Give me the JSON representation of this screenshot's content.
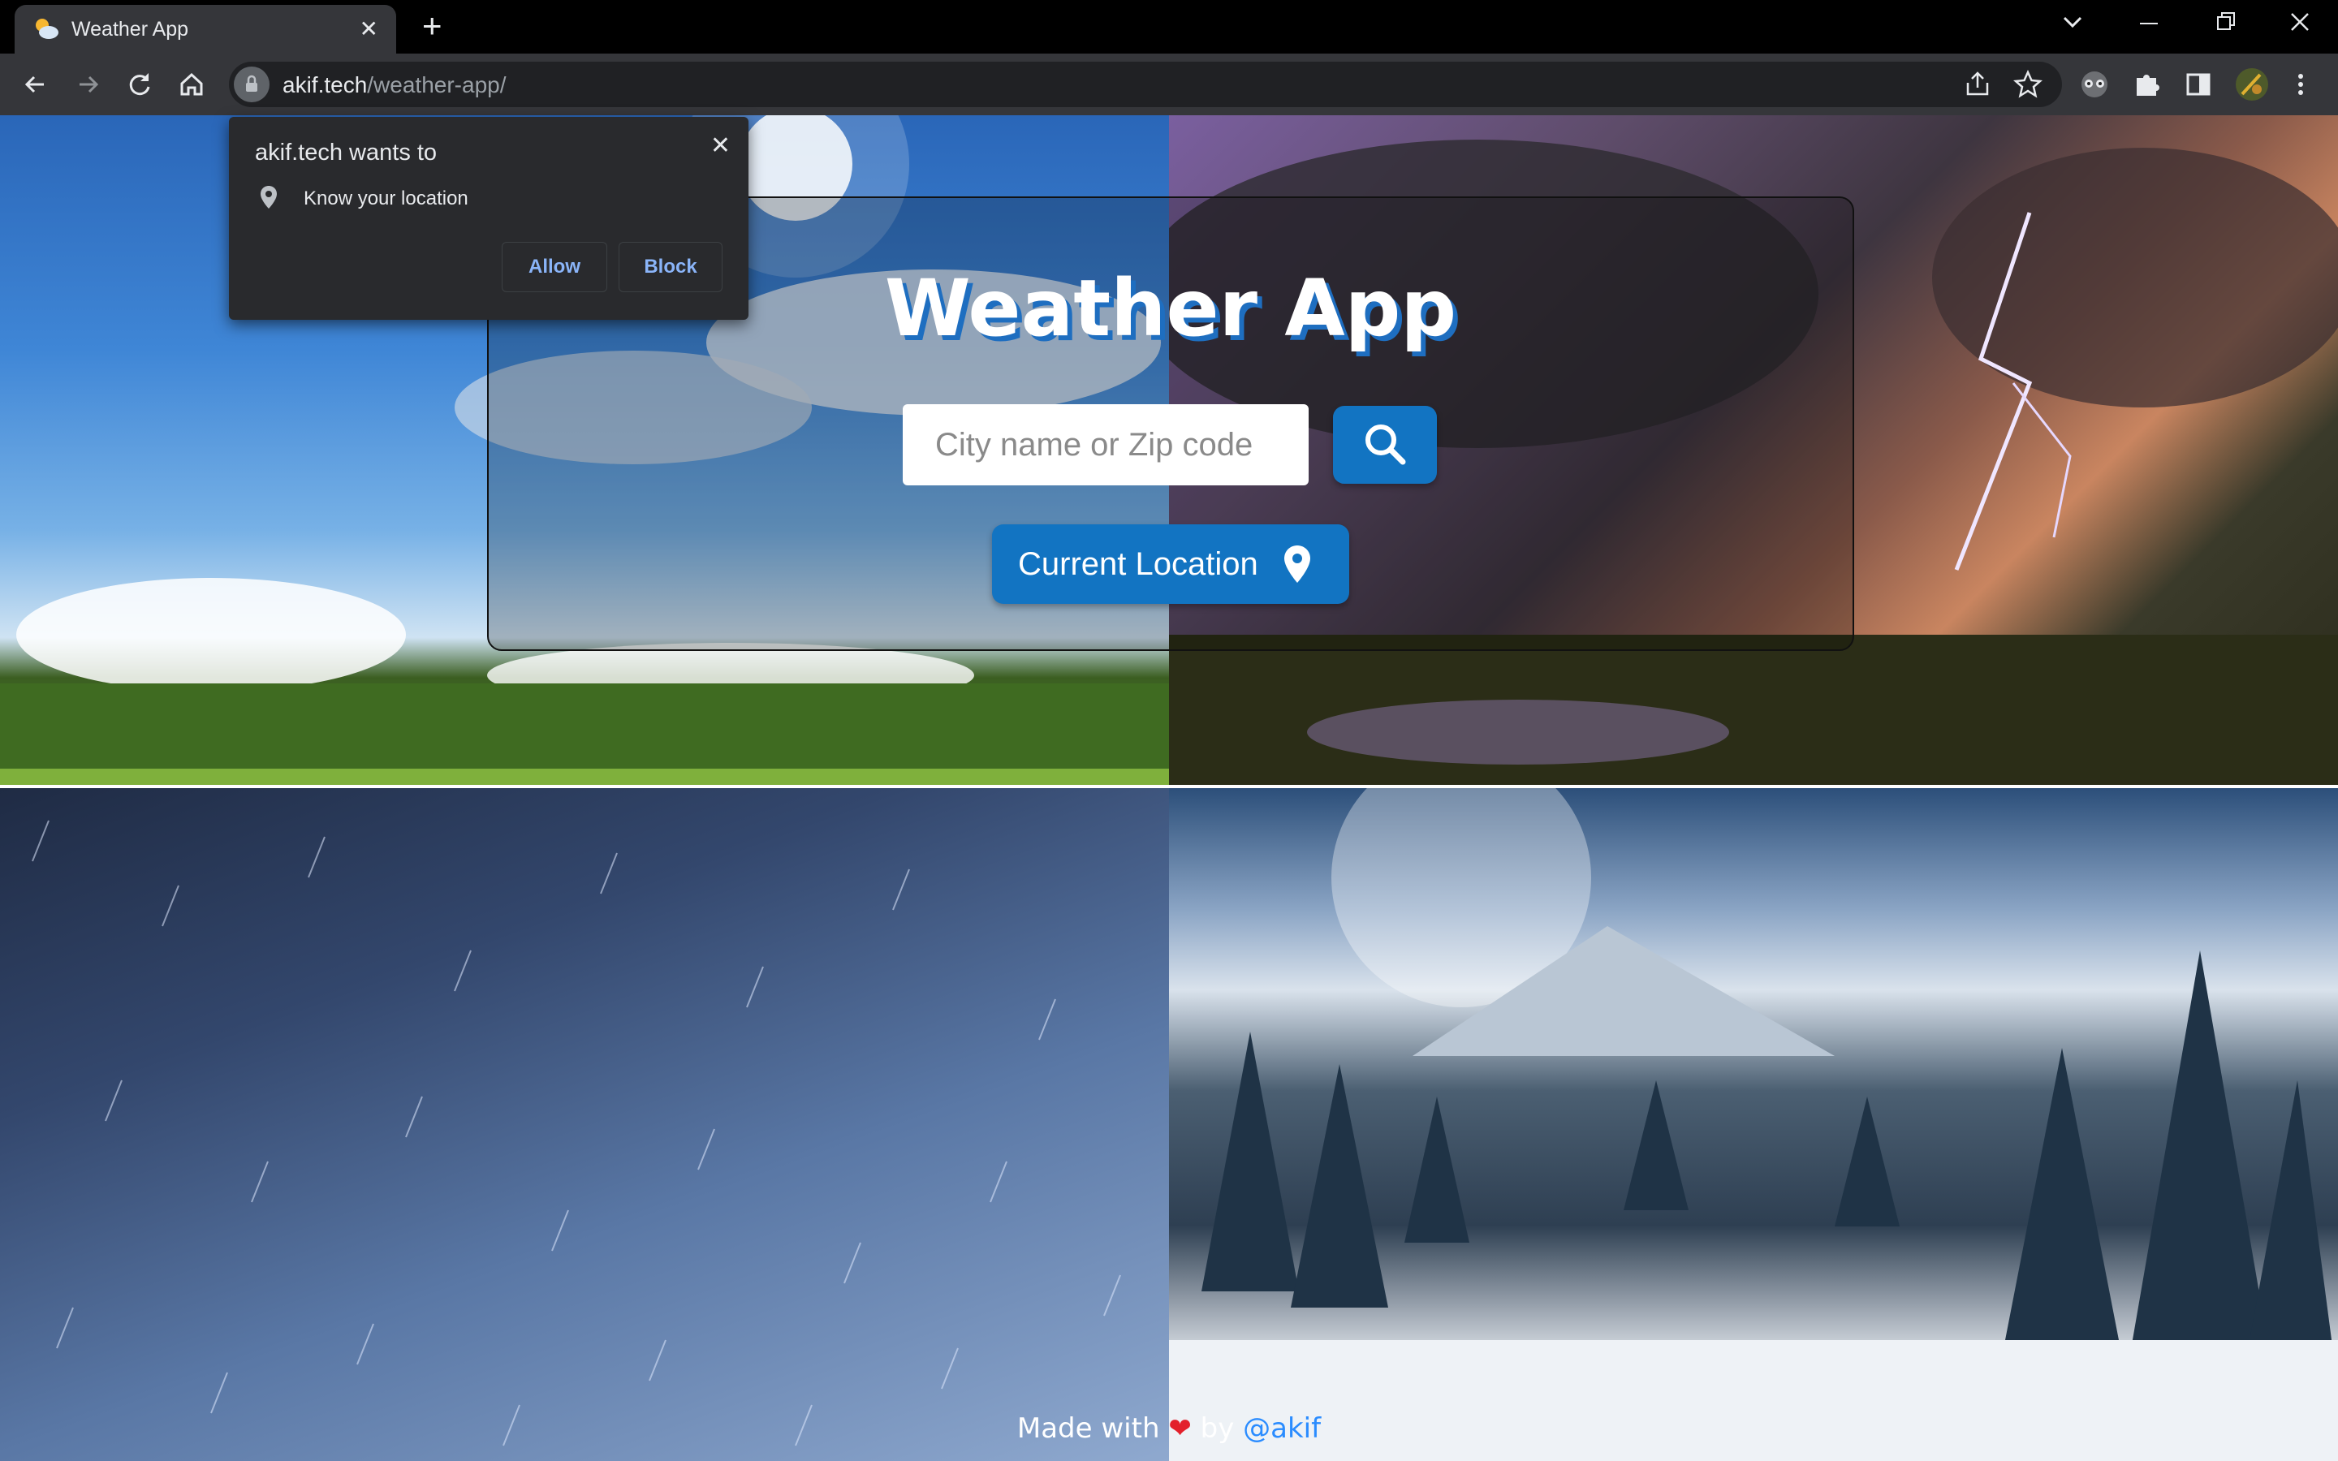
{
  "browser": {
    "tab_title": "Weather App",
    "tab_close": "✕",
    "new_tab": "+",
    "url_host": "akif.tech",
    "url_path": "/weather-app/"
  },
  "permission_prompt": {
    "title": "akif.tech wants to",
    "close": "✕",
    "request": "Know your location",
    "allow_label": "Allow",
    "block_label": "Block"
  },
  "app": {
    "title": "Weather App",
    "search_placeholder": "City name or Zip code",
    "current_location_label": "Current Location",
    "accent_color": "#1274c2"
  },
  "footer": {
    "made_with": "Made with",
    "heart": "❤",
    "by": "by",
    "author": "@akif"
  }
}
